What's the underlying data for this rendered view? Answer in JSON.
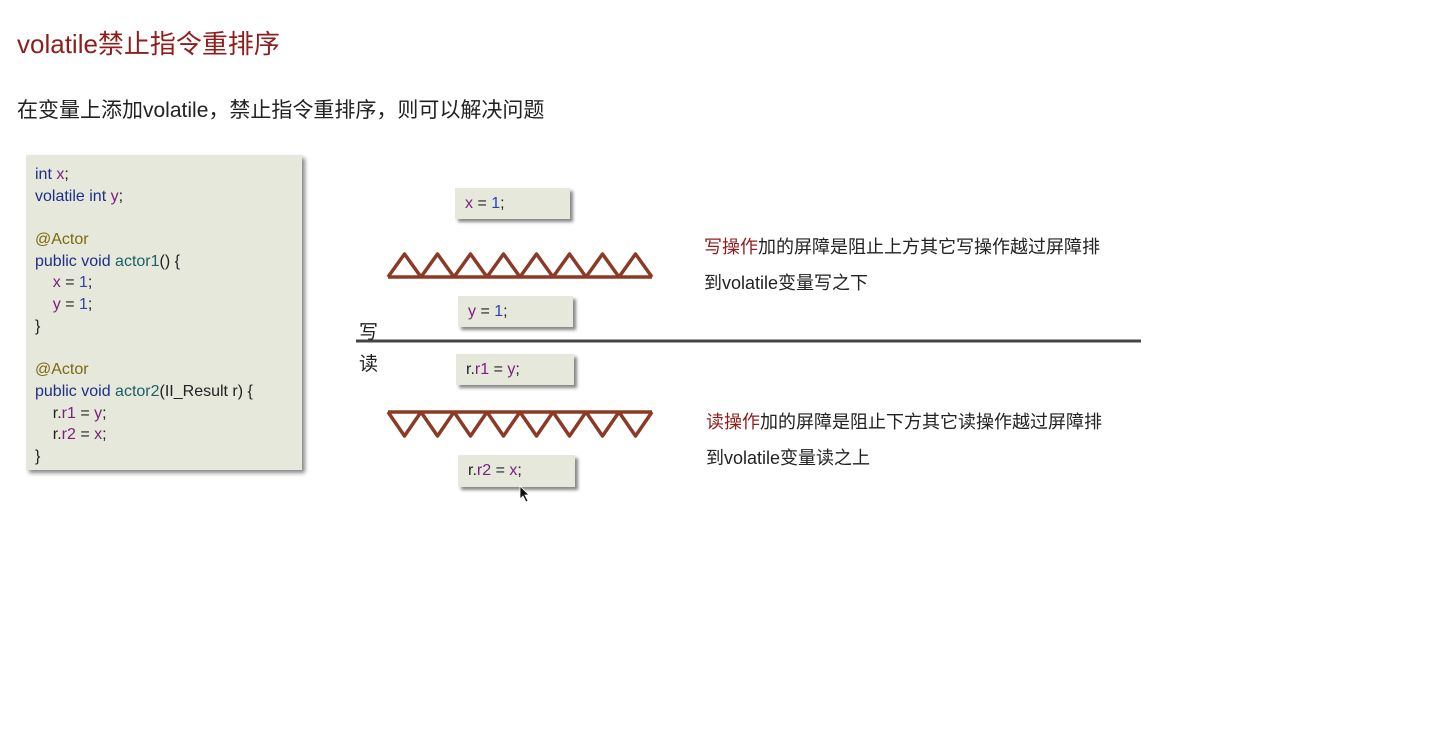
{
  "title": "volatile禁止指令重排序",
  "subtitle": "在变量上添加volatile，禁止指令重排序，则可以解决问题",
  "code": {
    "l1": {
      "a": "int ",
      "b": "x",
      ";": ";"
    },
    "l2": {
      "a": "volatile int ",
      "b": "y",
      ";": ";"
    },
    "ann": "@Actor",
    "l4": {
      "a": "public void ",
      "fn": "actor1",
      "c": "() {"
    },
    "l5": {
      "v": "x",
      " =": " = ",
      "n": "1",
      ";": ";"
    },
    "l6": {
      "v": "y",
      " =": " = ",
      "n": "1",
      ";": ";"
    },
    "close": "}",
    "l9": {
      "a": "public void ",
      "fn": "actor2",
      "c": "(II_Result r) {"
    },
    "l10": {
      "p": "r.",
      "v": "r1",
      "e": " = ",
      "w": "y",
      ";": ";"
    },
    "l11": {
      "p": "r.",
      "v": "r2",
      "e": " = ",
      "w": "x",
      ";": ";"
    }
  },
  "diagram": {
    "b1": {
      "v": "x",
      "e": " = ",
      "n": "1",
      ";": ";"
    },
    "b2": {
      "v": "y",
      "e": " = ",
      "n": "1",
      ";": ";"
    },
    "b3": {
      "p": "r.",
      "v": "r1",
      "e": " = ",
      "w": "y",
      ";": ";"
    },
    "b4": {
      "p": "r.",
      "v": "r2",
      "e": " = ",
      "w": "x",
      ";": ";"
    },
    "write_label": "写",
    "read_label": "读",
    "write_note": {
      "hl": "写操作",
      "rest": "加的屏障是阻止上方其它写操作越过屏障排",
      "line2": "到volatile变量写之下"
    },
    "read_note": {
      "hl": "读操作",
      "rest": "加的屏障是阻止下方其它读操作越过屏障排",
      "line2": "到volatile变量读之上"
    },
    "barrier_color": "#8b3a26"
  }
}
